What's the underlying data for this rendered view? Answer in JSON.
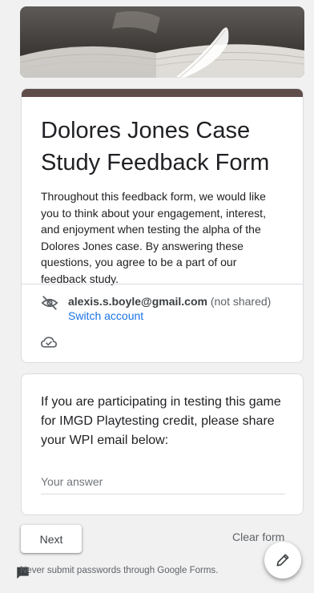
{
  "form": {
    "title": "Dolores Jones Case Study Feedback Form",
    "description": "Throughout this feedback form, we would like you to think about your engagement,  interest, and enjoyment when testing the alpha of the Dolores Jones case. By answering these questions, you agree to be a part of our feedback study.",
    "accent_color": "#5f4d4a"
  },
  "account": {
    "email": "alexis.s.boyle@gmail.com",
    "not_shared": "(not shared)",
    "switch_label": "Switch account"
  },
  "question": {
    "text": "If you are participating in testing this game for IMGD Playtesting credit, please share your WPI email below:",
    "placeholder": "Your answer"
  },
  "actions": {
    "next_label": "Next",
    "clear_label": "Clear form"
  },
  "footer": {
    "notice": "Never submit passwords through Google Forms."
  },
  "icons": {
    "account": "eye-off-icon",
    "draft": "cloud-check-icon",
    "feedback": "feedback-icon",
    "edit": "pencil-icon"
  }
}
